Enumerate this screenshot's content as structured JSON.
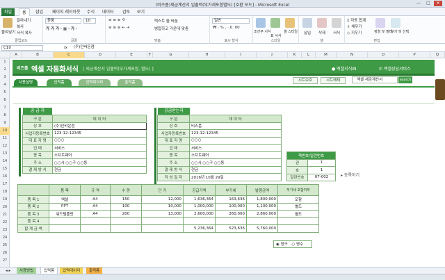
{
  "window": {
    "title": "(비즈폼)세금계산서 입출력(부가세포함별도) [호환 모드] - Microsoft Excel"
  },
  "ribbon": {
    "tabs": [
      "파일",
      "홈",
      "삽입",
      "페이지 레이아웃",
      "수식",
      "데이터",
      "검토",
      "보기"
    ],
    "clipboard": {
      "paste": "붙여넣기",
      "cut": "잘라내기",
      "copy": "복사",
      "format_painter": "서식 복사",
      "label": "클립보드"
    },
    "font": {
      "name": "돋움",
      "size": "10",
      "label": "글꼴"
    },
    "alignment": {
      "wrap": "텍스트 줄 바꿈",
      "merge": "병합하고 가운데 맞춤",
      "label": "맞춤"
    },
    "number": {
      "format": "일반",
      "label": "표시 형식"
    },
    "styles": {
      "conditional": "조건부 서식",
      "table": "표 서식",
      "cell": "셀 스타일",
      "label": "스타일"
    },
    "cells": {
      "insert": "삽입",
      "delete": "삭제",
      "format": "서식",
      "label": "셀"
    },
    "editing": {
      "autosum": "자동 합계",
      "fill": "채우기",
      "clear": "지우기",
      "sort": "정렬 및 필터",
      "find": "찾기 및 선택",
      "label": "편집"
    }
  },
  "formula_bar": {
    "name_box": "C10",
    "fx": "fx",
    "content": "(주)인바운점"
  },
  "columns": [
    "A",
    "B",
    "C",
    "D",
    "E",
    "F",
    "G",
    "H",
    "I",
    "J",
    "K",
    "L",
    "M",
    "N",
    "O",
    "P",
    "Q"
  ],
  "rows": [
    "1",
    "2",
    "3",
    "4",
    "5",
    "6",
    "7",
    "8",
    "9",
    "10",
    "11",
    "12",
    "13",
    "14",
    "15",
    "16",
    "17",
    "18",
    "19",
    "20",
    "21",
    "22",
    "23",
    "24",
    "25",
    "26",
    "27"
  ],
  "banner": {
    "brand": "비즈폼",
    "title": "엑셀 자동화서식",
    "subtitle": "[ 세금계산서 입출력(부가세포함, 별도) ]",
    "link_sites": "엑셀지식IN",
    "link_service": "엑셀상담서비스"
  },
  "sheet_tabs_form": [
    "사용설명",
    "입력폼",
    "입력데이터",
    "출력폼"
  ],
  "buttons": {
    "print_preview": "시트보호",
    "save": "시트해제",
    "search_placeholder": "엑셀 세금계산서",
    "search": "search",
    "register": "등록하기"
  },
  "supplier": {
    "title": "공 급 자",
    "header": [
      "구 분",
      "데 이 터"
    ],
    "rows": [
      {
        "label": "상 호",
        "value": "(주)인바운점"
      },
      {
        "label": "사업자등록번호",
        "value": "123-12-12345"
      },
      {
        "label": "대 표 자 명",
        "value": "○○○"
      },
      {
        "label": "업 태",
        "value": "서비스"
      },
      {
        "label": "종 목",
        "value": "소프트웨어"
      },
      {
        "label": "주 소",
        "value": "○○시 ○○구 ○○동"
      },
      {
        "label": "결 제 방 식",
        "value": "현금"
      }
    ]
  },
  "receiver": {
    "title": "공급받는자",
    "header": [
      "구 분",
      "데 이 터"
    ],
    "rows": [
      {
        "label": "상 호",
        "value": "비즈폼"
      },
      {
        "label": "사업자등록번호",
        "value": "123-12-12345"
      },
      {
        "label": "대 표 자 명",
        "value": "○○○"
      },
      {
        "label": "업 태",
        "value": "서비스"
      },
      {
        "label": "종 목",
        "value": "소프트웨어"
      },
      {
        "label": "주 소",
        "value": "○○시 ○○구 ○○동"
      },
      {
        "label": "결 제 방 식",
        "value": "현금"
      },
      {
        "label": "작 성 일 자",
        "value": "2016년 10월 29일"
      }
    ]
  },
  "bookno": {
    "title": "책번호/일련번호",
    "rows": [
      {
        "label": "권",
        "value": "1"
      },
      {
        "label": "호",
        "value": "1"
      },
      {
        "label": "일련번호",
        "value": "07-002"
      }
    ]
  },
  "items": {
    "header": [
      "품 목",
      "규 격",
      "수 량",
      "단 가",
      "공급가액",
      "부가세",
      "발행금액",
      "부가세 포함여부"
    ],
    "rows": [
      {
        "no": "품 목 1",
        "name": "엑셀",
        "spec": "A4",
        "qty": "150",
        "price": "12,000",
        "supply": "1,636,364",
        "vat": "163,636",
        "total": "1,800,000",
        "incl": "포함"
      },
      {
        "no": "품 목 2",
        "name": "PPT",
        "spec": "A4",
        "qty": "100",
        "price": "10,000",
        "supply": "1,000,000",
        "vat": "100,000",
        "total": "1,100,000",
        "incl": "별도"
      },
      {
        "no": "품 목 3",
        "name": "워드템플릿",
        "spec": "A4",
        "qty": "200",
        "price": "13,000",
        "supply": "2,600,000",
        "vat": "260,000",
        "total": "2,860,000",
        "incl": "별도"
      },
      {
        "no": "품 목 4",
        "name": "",
        "spec": "",
        "qty": "",
        "price": "",
        "supply": "",
        "vat": "",
        "total": "",
        "incl": ""
      }
    ],
    "sum_label": "합 계 금 액",
    "sum_supply": "5,236,364",
    "sum_vat": "523,636",
    "sum_total": "5,760,000"
  },
  "radio": {
    "option1": "청구",
    "option2": "영수"
  },
  "sheet_tabs": [
    "사용방법",
    "입력폼",
    "입력데이터",
    "출력폼"
  ],
  "colors": {
    "green": "#3f9a46",
    "dark_green": "#2b7a31",
    "label_bg": "#e4f1df"
  }
}
